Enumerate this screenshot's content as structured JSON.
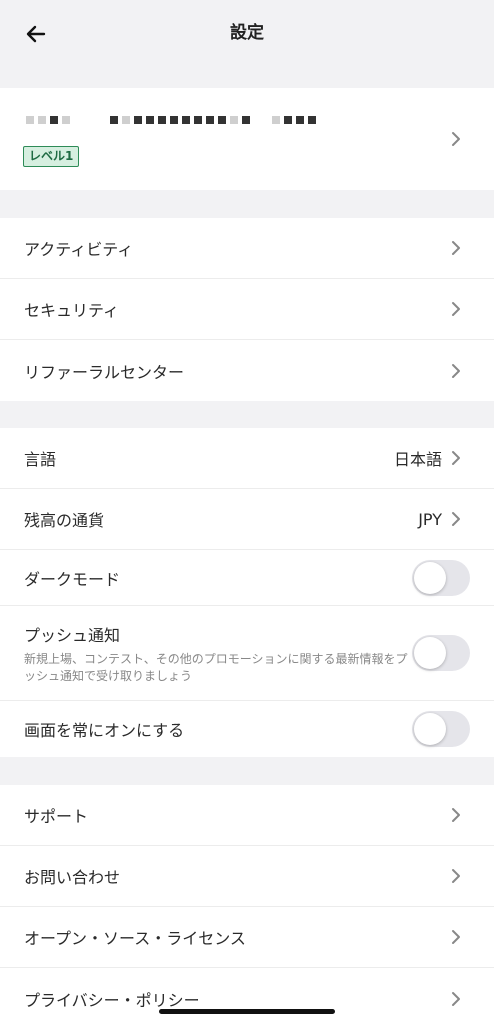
{
  "header": {
    "title": "設定",
    "back_icon": "arrow-left-icon"
  },
  "profile": {
    "level_badge": "レベル1",
    "chevron_icon": "chevron-right-icon"
  },
  "group1": [
    {
      "label": "アクティビティ"
    },
    {
      "label": "セキュリティ"
    },
    {
      "label": "リファーラルセンター"
    }
  ],
  "group2": {
    "language": {
      "label": "言語",
      "value": "日本語"
    },
    "currency": {
      "label": "残高の通貨",
      "value": "JPY"
    },
    "dark_mode": {
      "label": "ダークモード",
      "enabled": false
    },
    "push": {
      "label": "プッシュ通知",
      "description": "新規上場、コンテスト、その他のプロモーションに関する最新情報をプッシュ通知で受け取りましょう",
      "enabled": false
    },
    "screen_on": {
      "label": "画面を常にオンにする",
      "enabled": false
    }
  },
  "group3": [
    {
      "label": "サポート"
    },
    {
      "label": "お問い合わせ"
    },
    {
      "label": "オープン・ソース・ライセンス"
    },
    {
      "label": "プライバシー・ポリシー"
    }
  ],
  "colors": {
    "background": "#f2f2f4",
    "badge_border": "#2e8b57",
    "badge_fill": "#d6efe0",
    "toggle_off": "#e5e5ea"
  }
}
